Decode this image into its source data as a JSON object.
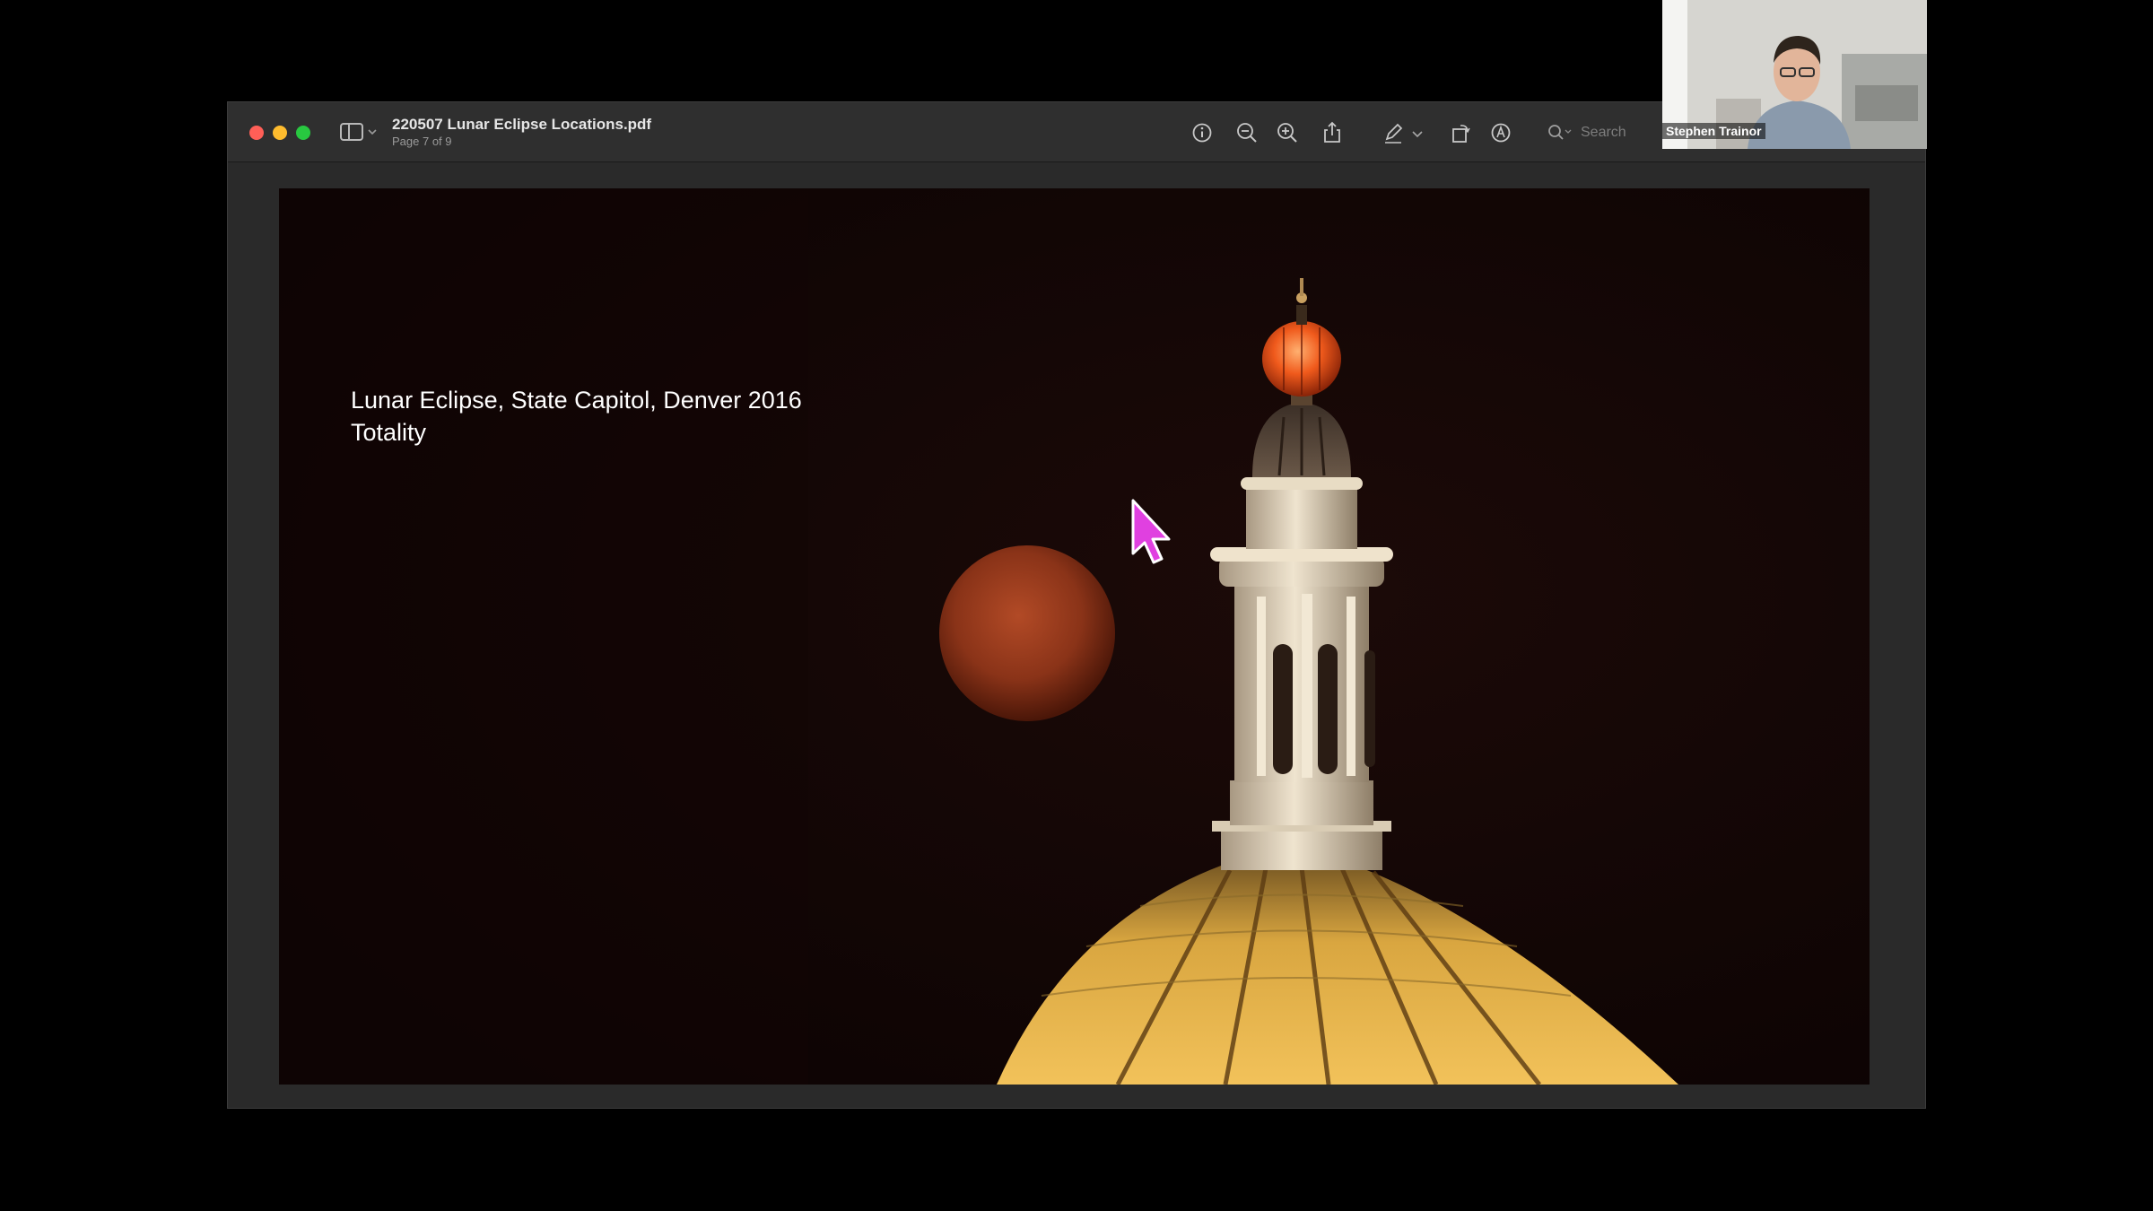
{
  "window": {
    "file_title": "220507 Lunar Eclipse Locations.pdf",
    "page_indicator": "Page 7 of 9"
  },
  "toolbar": {
    "icons": [
      "info-icon",
      "zoom-out-icon",
      "zoom-in-icon",
      "share-icon",
      "markup-pen-icon",
      "chevron-down-icon",
      "rotate-icon",
      "annotate-icon",
      "search-icon"
    ],
    "search_placeholder": "Search"
  },
  "slide": {
    "title_line1": "Lunar Eclipse, State Capitol, Denver 2016",
    "title_line2": "Totality"
  },
  "webcam": {
    "participant_name": "Stephen Trainor"
  },
  "colors": {
    "close": "#ff5f57",
    "minimize": "#febc2e",
    "maximize": "#28c840",
    "cursor": "#e040e0"
  }
}
